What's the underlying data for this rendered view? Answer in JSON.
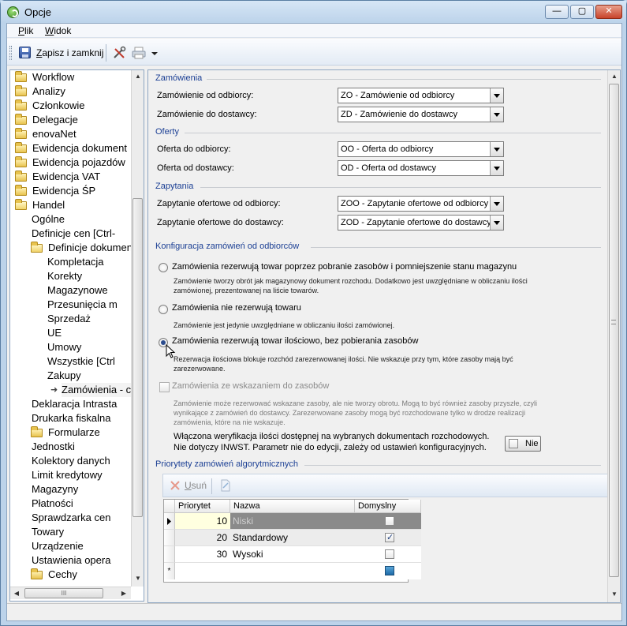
{
  "window": {
    "title": "Opcje",
    "min": "—",
    "max": "▢",
    "close": "✕"
  },
  "menu": [
    {
      "label": "Plik",
      "mnemonic": "P",
      "rest": "lik"
    },
    {
      "label": "Widok",
      "mnemonic": "W",
      "rest": "idok"
    }
  ],
  "toolbar": {
    "save_label": "Zapisz i zamknij",
    "save_mnemonic": "Z",
    "save_rest": "apisz i zamknij"
  },
  "tree": {
    "items": [
      {
        "label": "Workflow",
        "level": 0,
        "icon": "folder"
      },
      {
        "label": "Analizy",
        "level": 0,
        "icon": "folder"
      },
      {
        "label": "Członkowie",
        "level": 0,
        "icon": "folder"
      },
      {
        "label": "Delegacje",
        "level": 0,
        "icon": "folder"
      },
      {
        "label": "enovaNet",
        "level": 0,
        "icon": "folder"
      },
      {
        "label": "Ewidencja dokument",
        "level": 0,
        "icon": "folder"
      },
      {
        "label": "Ewidencja pojazdów",
        "level": 0,
        "icon": "folder"
      },
      {
        "label": "Ewidencja VAT",
        "level": 0,
        "icon": "folder"
      },
      {
        "label": "Ewidencja ŚP",
        "level": 0,
        "icon": "folder"
      },
      {
        "label": "Handel",
        "level": 0,
        "icon": "folder-open"
      },
      {
        "label": "Ogólne",
        "level": 1,
        "icon": ""
      },
      {
        "label": "Definicje cen [Ctrl-",
        "level": 1,
        "icon": ""
      },
      {
        "label": "Definicje dokumen",
        "level": 1,
        "icon": "folder-open"
      },
      {
        "label": "Kompletacja",
        "level": 2,
        "icon": ""
      },
      {
        "label": "Korekty",
        "level": 2,
        "icon": ""
      },
      {
        "label": "Magazynowe",
        "level": 2,
        "icon": ""
      },
      {
        "label": "Przesunięcia m",
        "level": 2,
        "icon": ""
      },
      {
        "label": "Sprzedaż",
        "level": 2,
        "icon": ""
      },
      {
        "label": "UE",
        "level": 2,
        "icon": ""
      },
      {
        "label": "Umowy",
        "level": 2,
        "icon": ""
      },
      {
        "label": "Wszystkie [Ctrl",
        "level": 2,
        "icon": ""
      },
      {
        "label": "Zakupy",
        "level": 2,
        "icon": ""
      },
      {
        "label": "Zamówienia - c",
        "level": 2,
        "icon": "arrow",
        "selected": true
      },
      {
        "label": "Deklaracja Intrastа",
        "level": 1,
        "icon": ""
      },
      {
        "label": "Drukarka fiskalna",
        "level": 1,
        "icon": ""
      },
      {
        "label": "Formularze",
        "level": 1,
        "icon": "folder"
      },
      {
        "label": "Jednostki",
        "level": 1,
        "icon": ""
      },
      {
        "label": "Kolektory danych",
        "level": 1,
        "icon": ""
      },
      {
        "label": "Limit kredytowy",
        "level": 1,
        "icon": ""
      },
      {
        "label": "Magazyny",
        "level": 1,
        "icon": ""
      },
      {
        "label": "Płatności",
        "level": 1,
        "icon": ""
      },
      {
        "label": "Sprawdzarka cen",
        "level": 1,
        "icon": ""
      },
      {
        "label": "Towary",
        "level": 1,
        "icon": ""
      },
      {
        "label": "Urządzenie",
        "level": 1,
        "icon": ""
      },
      {
        "label": "Ustawienia opera",
        "level": 1,
        "icon": ""
      },
      {
        "label": "Cechy",
        "level": 1,
        "icon": "folder"
      }
    ],
    "hscroll_text": "III"
  },
  "zamowienia": {
    "title": "Zamówienia",
    "odbiorcy_label": "Zamówienie od odbiorcy:",
    "odbiorcy_value": "ZO - Zamówienie od odbiorcy",
    "dostawcy_label": "Zamówienie do dostawcy:",
    "dostawcy_value": "ZD - Zamówienie do dostawcy"
  },
  "oferty": {
    "title": "Oferty",
    "odbiorcy_label": "Oferta do odbiorcy:",
    "odbiorcy_value": "OO - Oferta do odbiorcy",
    "dostawcy_label": "Oferta od dostawcy:",
    "dostawcy_value": "OD - Oferta od dostawcy"
  },
  "zapytania": {
    "title": "Zapytania",
    "odbiorcy_label": "Zapytanie ofertowe od odbiorcy:",
    "odbiorcy_value": "ZOO - Zapytanie ofertowe od odbiorcy",
    "dostawcy_label": "Zapytanie ofertowe do dostawcy:",
    "dostawcy_value": "ZOD - Zapytanie ofertowe do dostawcy"
  },
  "konfiguracja": {
    "title": "Konfiguracja zamówień od odbiorców",
    "opt1_label": "Zamówienia rezerwują towar poprzez pobranie zasobów i pomniejszenie stanu magazynu",
    "opt1_desc1": "Zamówienie tworzy obrót jak magazynowy dokument rozchodu. Dodatkowo jest uwzględniane w obliczaniu ilości",
    "opt1_desc2": "zamówionej, prezentowanej na liście towarów.",
    "opt2_label": "Zamówienia nie rezerwują towaru",
    "opt2_desc1": "Zamówienie jest jedynie uwzględniane w obliczaniu ilości zamówionej.",
    "opt3_label": "Zamówienia rezerwują towar ilościowo, bez pobierania zasobów",
    "opt3_desc1": "Rezerwacja ilościowa blokuje rozchód zarezerwowanej ilości. Nie wskazuje przy tym, które zasoby mają być",
    "opt3_desc2": "zarezerwowane.",
    "chk_label": "Zamówienia ze wskazaniem do zasobów",
    "chk_desc1": "Zamówienie może rezerwować wskazane zasoby, ale nie tworzy obrotu. Mogą to być również zasoby przyszłe, czyli",
    "chk_desc2": "wynikające z zamówień do dostawcy.  Zarezerwowane zasoby mogą być rozchodowane tylko w drodze realizacji",
    "chk_desc3": "zamówienia, które na nie wskazuje.",
    "weryf_line1": "Włączona weryfikacja ilości dostępnej na wybranych dokumentach rozchodowych.",
    "weryf_line2": "Nie dotyczy INWST. Parametr nie do edycji, zależy od ustawień konfiguracyjnych.",
    "weryf_value": "Nie"
  },
  "priorytety": {
    "title": "Priorytety zamówień algorytmicznych",
    "delete_label": "Usuń",
    "delete_mnemonic": "U",
    "delete_rest": "suń",
    "columns": [
      "Priorytet",
      "Nazwa",
      "Domyslny"
    ],
    "rows": [
      {
        "priorytet": "10",
        "nazwa": "Niski",
        "domyslny": false
      },
      {
        "priorytet": "20",
        "nazwa": "Standardowy",
        "domyslny": true
      },
      {
        "priorytet": "30",
        "nazwa": "Wysoki",
        "domyslny": false
      }
    ],
    "new_row_marker": "*"
  },
  "colors": {
    "section": "#1b3f94",
    "selected_row": "#8a8a8a",
    "priority_cell": "#ffffe0"
  }
}
